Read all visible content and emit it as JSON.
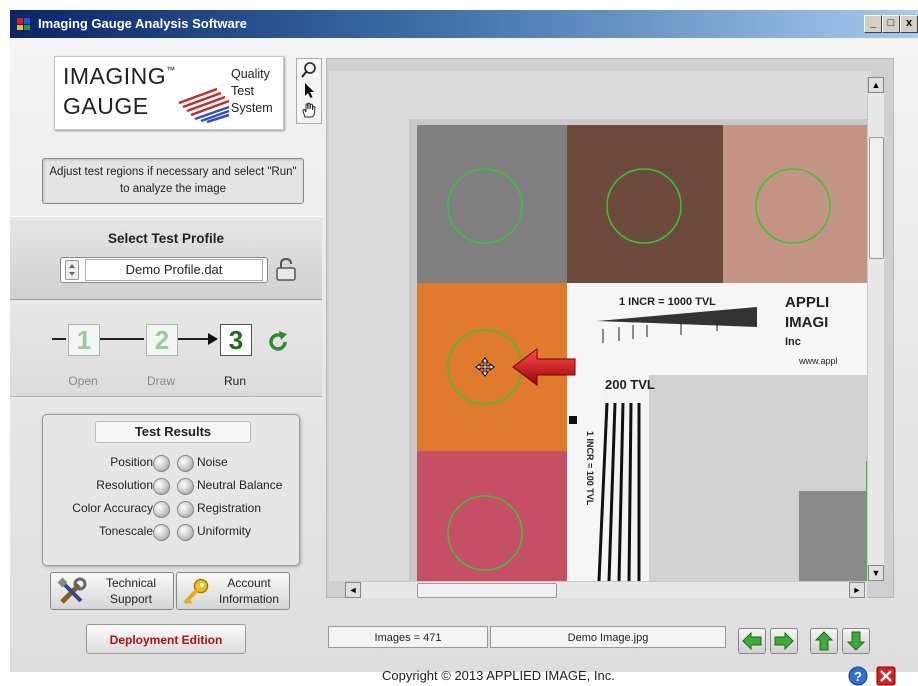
{
  "window": {
    "title": "Imaging Gauge Analysis Software"
  },
  "logo": {
    "line1": "IMAGING",
    "line2": "GAUGE",
    "tm": "™",
    "tag1": "Quality",
    "tag2": "Test",
    "tag3": "System"
  },
  "tools": [
    "zoom-icon",
    "pointer-icon",
    "hand-icon"
  ],
  "instructions": "Adjust test regions if necessary and select \"Run\" to analyze the image",
  "profile": {
    "title": "Select Test Profile",
    "value": "Demo Profile.dat"
  },
  "steps": [
    {
      "num": "1",
      "label": "Open"
    },
    {
      "num": "2",
      "label": "Draw"
    },
    {
      "num": "3",
      "label": "Run"
    }
  ],
  "results": {
    "title": "Test Results",
    "left": [
      "Position",
      "Resolution",
      "Color Accuracy",
      "Tonescale"
    ],
    "right": [
      "Noise",
      "Neutral Balance",
      "Registration",
      "Uniformity"
    ]
  },
  "buttons": {
    "tech_line1": "Technical",
    "tech_line2": "Support",
    "acct_line1": "Account",
    "acct_line2": "Information",
    "deploy": "Deployment Edition"
  },
  "chart_texts": {
    "incr_top": "1 INCR = 1000 TVL",
    "tvl": "200 TVL",
    "incr_side": "1 INCR = 100 TVL",
    "brand1": "APPLI",
    "brand2": "IMAGI",
    "brand3": "Inc",
    "url": "www.appl"
  },
  "status": {
    "images": "Images = 471",
    "filename": "Demo Image.jpg"
  },
  "copyright": "Copyright © 2013 APPLIED IMAGE, Inc.",
  "colors": {
    "accent_green": "#3fa83f",
    "title_blue": "#0a246a",
    "arrow_red": "#cc1010"
  }
}
